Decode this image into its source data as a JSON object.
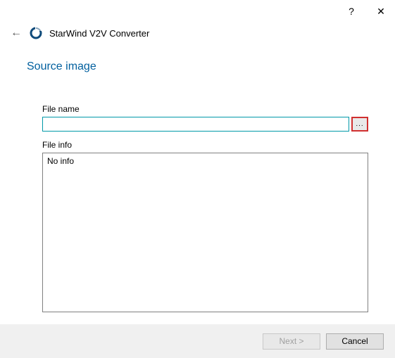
{
  "titlebar": {
    "help_glyph": "?",
    "close_glyph": "✕"
  },
  "header": {
    "back_glyph": "←",
    "app_title": "StarWind V2V Converter"
  },
  "page": {
    "title": "Source image",
    "filename_label": "File name",
    "filename_value": "",
    "browse_label": "...",
    "fileinfo_label": "File info",
    "fileinfo_content": "No info"
  },
  "footer": {
    "next_label": "Next >",
    "cancel_label": "Cancel"
  }
}
